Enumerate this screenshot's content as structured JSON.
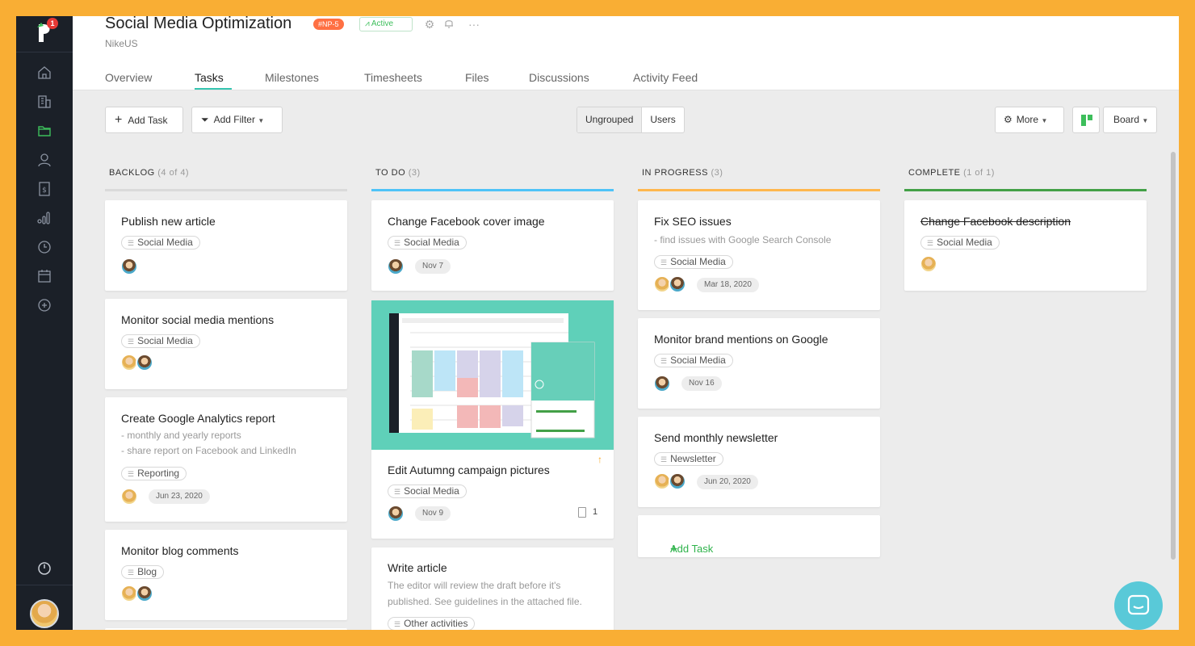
{
  "sidebar": {
    "notification_count": "1",
    "icons": [
      "home-icon",
      "building-icon",
      "folder-icon",
      "user-icon",
      "invoice-icon",
      "reports-icon",
      "clock-icon",
      "calendar-icon",
      "add-circle-icon",
      "power-icon"
    ]
  },
  "header": {
    "title": "Social Media Optimization",
    "project_code": "#NP-5",
    "status": "Active",
    "client": "NikeUS",
    "tabs": [
      {
        "label": "Overview"
      },
      {
        "label": "Tasks"
      },
      {
        "label": "Milestones"
      },
      {
        "label": "Timesheets"
      },
      {
        "label": "Files"
      },
      {
        "label": "Discussions"
      },
      {
        "label": "Activity Feed"
      }
    ],
    "active_tab": "Tasks"
  },
  "toolbar": {
    "add_task": "Add Task",
    "add_filter": "Add Filter",
    "grouping": [
      "Ungrouped",
      "Users"
    ],
    "grouping_selected": "Ungrouped",
    "more": "More",
    "view": "Board"
  },
  "columns": [
    {
      "name": "BACKLOG",
      "count": "(4 of 4)",
      "color": "#DADADA",
      "cards": [
        {
          "title": "Publish new article",
          "tag": "Social Media"
        },
        {
          "title": "Monitor social media mentions",
          "tag": "Social Media"
        },
        {
          "title": "Create Google Analytics report",
          "desc": [
            "- monthly and yearly reports",
            "- share report on Facebook and LinkedIn"
          ],
          "tag": "Reporting",
          "date": "Jun 23, 2020"
        },
        {
          "title": "Monitor blog comments",
          "tag": "Blog"
        }
      ]
    },
    {
      "name": "TO DO",
      "count": "(3)",
      "color": "#4FC3F7",
      "cards": [
        {
          "title": "Change Facebook cover image",
          "tag": "Social Media",
          "date": "Nov 7"
        },
        {
          "title": "Edit Autumng campaign pictures",
          "tag": "Social Media",
          "date": "Nov 9",
          "attachments": "1"
        },
        {
          "title": "Write article",
          "desc": [
            "The editor will review the draft before it's",
            "published. See guidelines in the attached file."
          ],
          "tag": "Other activities"
        }
      ]
    },
    {
      "name": "IN PROGRESS",
      "count": "(3)",
      "color": "#FFB74D",
      "cards": [
        {
          "title": "Fix SEO issues",
          "desc": [
            "- find issues with Google Search Console"
          ],
          "tag": "Social Media",
          "date": "Mar 18, 2020"
        },
        {
          "title": "Monitor brand mentions on Google",
          "tag": "Social Media",
          "date": "Nov 16"
        },
        {
          "title": "Send monthly newsletter",
          "tag": "Newsletter",
          "date": "Jun 20, 2020"
        }
      ],
      "add_task": "Add Task"
    },
    {
      "name": "COMPLETE",
      "count": "(1 of 1)",
      "color": "#43A047",
      "cards": [
        {
          "title": "Change Facebook description",
          "tag": "Social Media",
          "done": true
        }
      ]
    }
  ],
  "colors": {
    "accent": "#35C5B0",
    "sidebar": "#1B2028",
    "project_badge": "#FF7043",
    "active_green": "#3DBE5B",
    "add_task_green": "#2EB34B",
    "chat_button": "#59C9D8"
  }
}
